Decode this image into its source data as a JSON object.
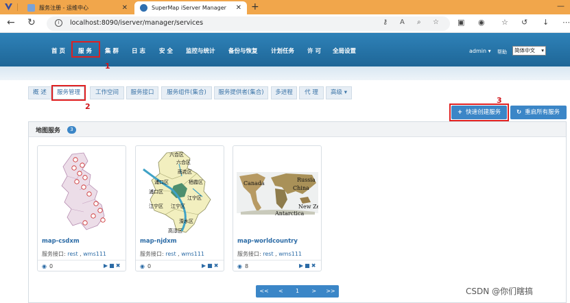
{
  "browser": {
    "tabs": [
      {
        "title": "服务注册 - 运维中心"
      },
      {
        "title": "SuperMap iServer Manager"
      }
    ],
    "url": "localhost:8090/iserver/manager/services"
  },
  "app": {
    "menu": [
      "首 页",
      "服 务",
      "集 群",
      "日 志",
      "安 全",
      "监控与统计",
      "备份与恢复",
      "计划任务",
      "许 可",
      "全局设置"
    ],
    "user": "admin ▾",
    "help": "帮助",
    "language": "简体中文"
  },
  "subnav": {
    "tabs": [
      "概 述",
      "服务管理",
      "工作空间",
      "服务接口",
      "服务组件(集合)",
      "服务提供者(集合)",
      "多进程",
      "代 理",
      "高级 ▾"
    ]
  },
  "actions": {
    "quick_create": "快速创建服务",
    "restart_all": "重启所有服务"
  },
  "annotations": [
    "1",
    "2",
    "3"
  ],
  "panel": {
    "title": "地图服务",
    "count": "3"
  },
  "services": [
    {
      "name": "map-csdxm",
      "interface_label": "服务接口:",
      "iface_rest": "rest",
      "sep": " , ",
      "iface_wms": "wms111",
      "views": "0",
      "thumb_labels": []
    },
    {
      "name": "map-njdxm",
      "interface_label": "服务接口:",
      "iface_rest": "rest",
      "sep": " , ",
      "iface_wms": "wms111",
      "views": "0",
      "thumb_labels": [
        "六合区",
        "六合区",
        "雨花区",
        "浦口区",
        "栖霞区",
        "浦口区",
        "江宁区",
        "江宁区",
        "江宁区",
        "溧水区",
        "高淳区"
      ]
    },
    {
      "name": "map-worldcountry",
      "interface_label": "服务接口:",
      "iface_rest": "rest",
      "sep": " , ",
      "iface_wms": "wms111",
      "views": "8",
      "thumb_labels": [
        "Canada",
        "Russia",
        "China",
        "New Ze",
        "Antarctica"
      ]
    }
  ],
  "pagination": [
    "<<",
    "<",
    "1",
    ">",
    ">>"
  ],
  "watermark": "CSDN @你们瞎搞",
  "colors": {
    "header": "#2f82b8",
    "accent": "#3b86c7",
    "annotation": "#d0151b",
    "tabstrip": "#f1a64b"
  }
}
